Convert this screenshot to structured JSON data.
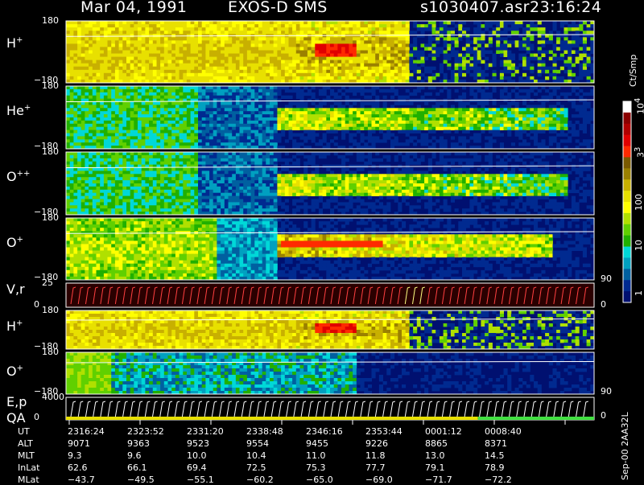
{
  "header": {
    "date": "Mar 04, 1991",
    "instrument": "EXOS-D SMS",
    "file": "s1030407.asr",
    "time": "23:16:24"
  },
  "panels": [
    {
      "label": "H",
      "sup": "+",
      "ymax": "180",
      "ymin": "−180"
    },
    {
      "label": "He",
      "sup": "+",
      "ymax": "180",
      "ymin": "−180"
    },
    {
      "label": "O",
      "sup": "++",
      "ymax": "180",
      "ymin": "−180"
    },
    {
      "label": "O",
      "sup": "+",
      "ymax": "180",
      "ymin": "−180"
    },
    {
      "label": "V,r",
      "sup": "",
      "ymax": "25",
      "ymin": "0"
    },
    {
      "label": "H",
      "sup": "+",
      "ymax": "180",
      "ymin": "−180"
    },
    {
      "label": "O",
      "sup": "+",
      "ymax": "180",
      "ymin": "−180"
    },
    {
      "label": "E,p",
      "sub": "QA",
      "ymax": "4000",
      "ymin": "0"
    }
  ],
  "right_axis": {
    "vr_top": "90",
    "vr_bottom": "0",
    "o_top": "90",
    "ep_bottom": "0"
  },
  "colorbar": {
    "unit": "Ct/Smp",
    "ticks": [
      "10",
      "3",
      "100",
      "10",
      "1"
    ],
    "tick_exps": [
      "4",
      "3",
      "",
      "",
      ""
    ],
    "colors": [
      "#ffffff",
      "#8a0000",
      "#b00000",
      "#e00000",
      "#ff2a00",
      "#7a5a00",
      "#9a8000",
      "#c8b000",
      "#e8e000",
      "#ffff00",
      "#b0e000",
      "#60d000",
      "#20b000",
      "#00d8d8",
      "#00a0c0",
      "#0060a0",
      "#002a90",
      "#001070"
    ]
  },
  "footer": {
    "version": "Sep-00  2AA32L"
  },
  "chart_data": {
    "type": "heatmap",
    "title": "Mar 04, 1991   EXOS-D SMS",
    "x_tick_labels": [
      "2316:24",
      "2323:52",
      "2331:20",
      "2338:48",
      "2346:16",
      "2353:44",
      "0001:12",
      "0008:40"
    ],
    "color_scale": {
      "unit": "Ct/Smp",
      "range": [
        1,
        10000
      ],
      "scale": "log"
    },
    "ephemeris": {
      "UT": [
        "2316:24",
        "2323:52",
        "2331:20",
        "2338:48",
        "2346:16",
        "2353:44",
        "0001:12",
        "0008:40"
      ],
      "ALT": [
        "9071",
        "9363",
        "9523",
        "9554",
        "9455",
        "9226",
        "8865",
        "8371"
      ],
      "MLT": [
        "9.3",
        "9.6",
        "10.0",
        "10.4",
        "11.0",
        "11.8",
        "13.0",
        "14.5"
      ],
      "InLat": [
        "62.6",
        "66.1",
        "69.4",
        "72.5",
        "75.3",
        "77.7",
        "79.1",
        "78.9"
      ],
      "MLat": [
        "−43.7",
        "−49.5",
        "−55.1",
        "−60.2",
        "−65.0",
        "−69.0",
        "−71.7",
        "−72.2"
      ]
    }
  }
}
